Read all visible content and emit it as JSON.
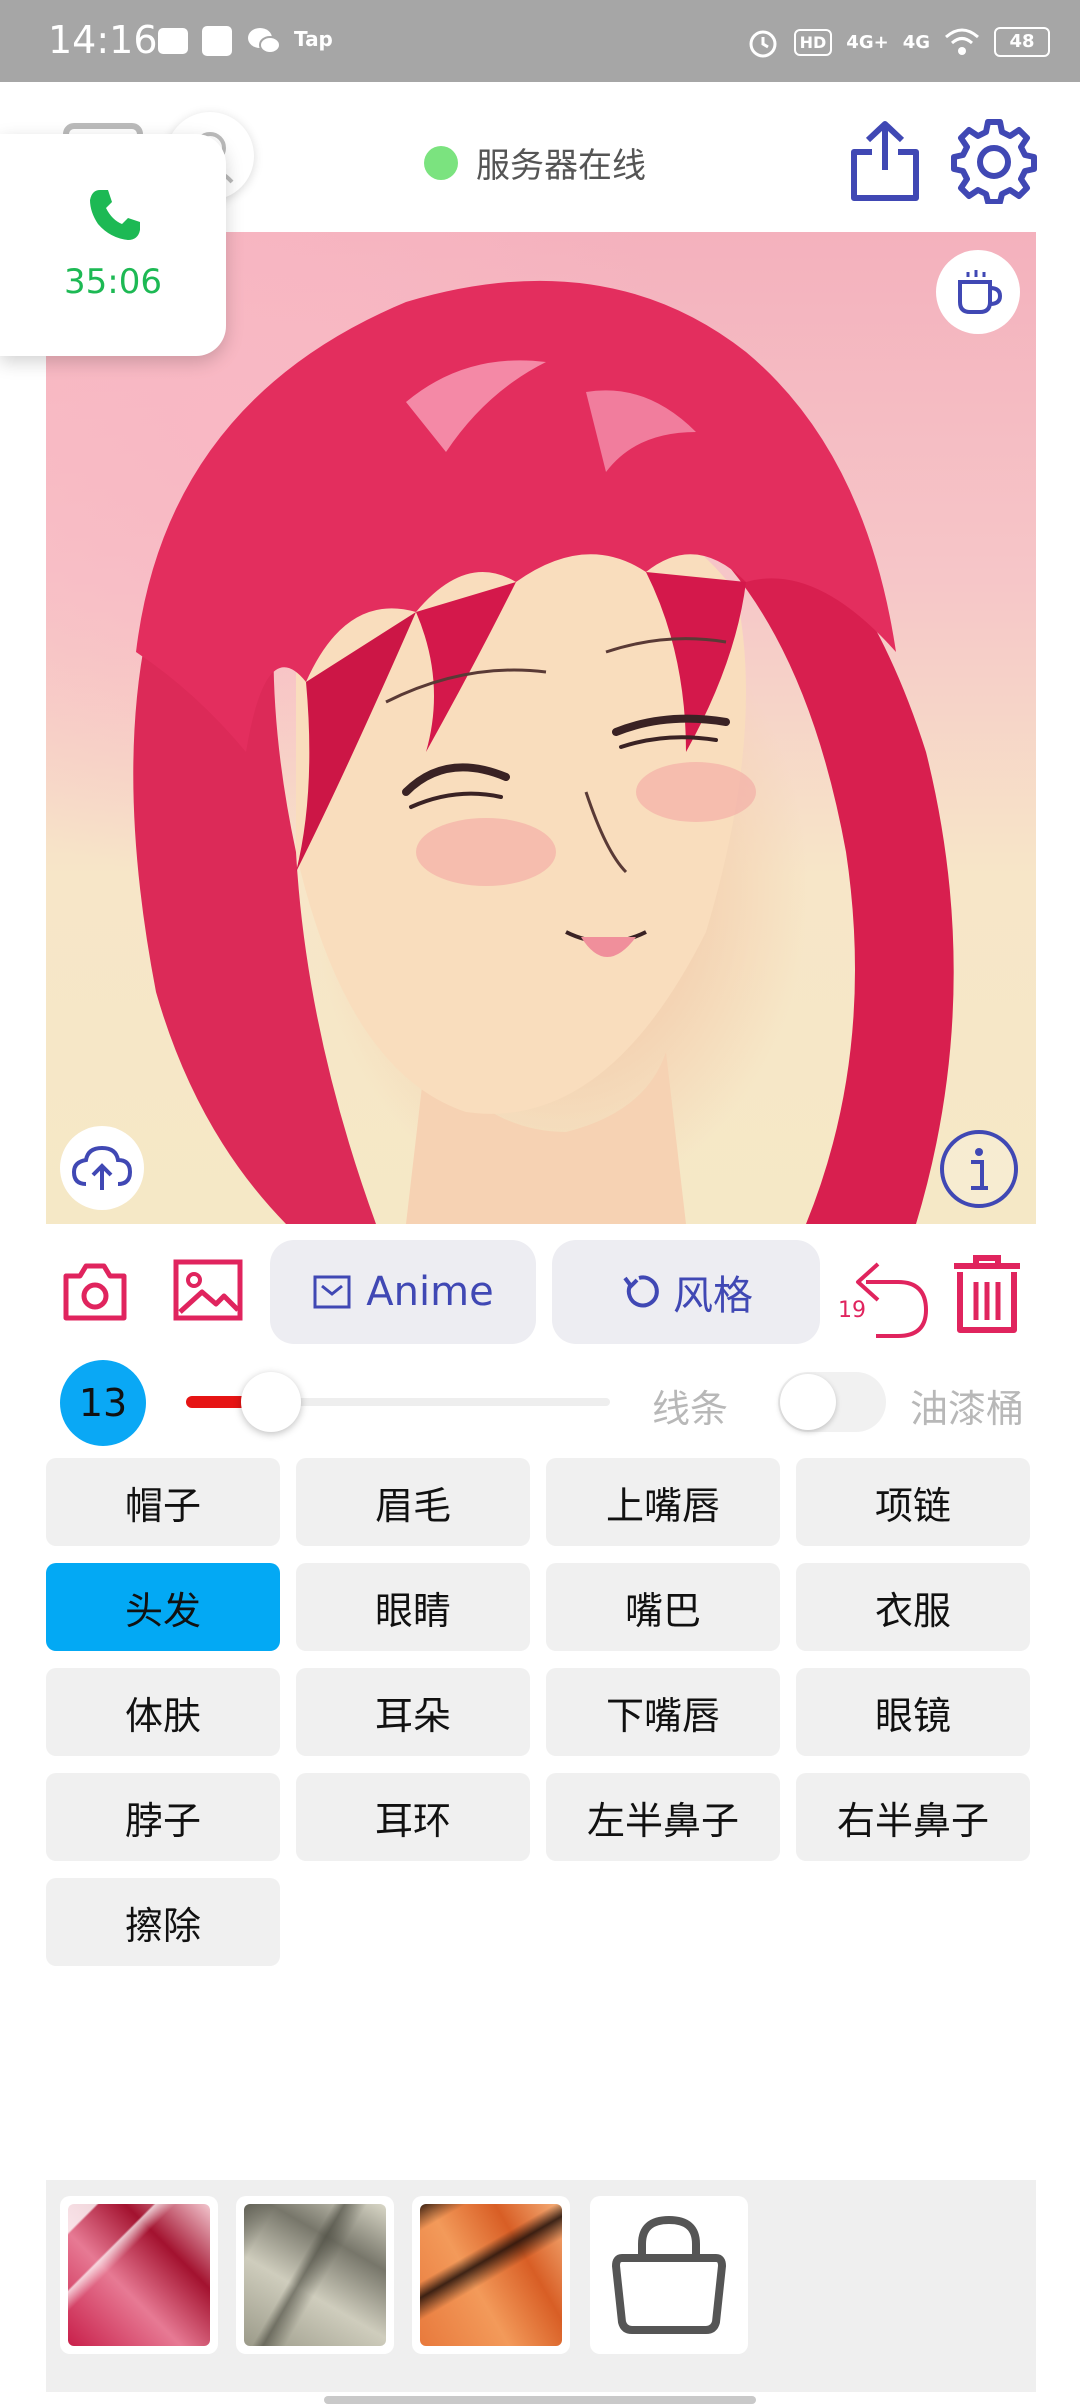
{
  "status_bar": {
    "time": "14:16",
    "tap_label": "Tap",
    "hd_badge": "HD",
    "net1": "4G+",
    "net2": "4G",
    "battery": "48"
  },
  "header": {
    "server_status": "服务器在线",
    "status_color": "#7be37f"
  },
  "call": {
    "timer": "35:06",
    "color": "#1db954"
  },
  "toolbar": {
    "anime_label": "Anime",
    "style_label": "风格",
    "undo_count": "19",
    "accent": "#e0245e",
    "primary": "#4048b4"
  },
  "brush": {
    "size": "13",
    "slider_value": 0.2,
    "lines_label": "线条",
    "lines_toggle": false,
    "bucket_label": "油漆桶"
  },
  "parts": [
    {
      "label": "帽子",
      "active": false
    },
    {
      "label": "眉毛",
      "active": false
    },
    {
      "label": "上嘴唇",
      "active": false
    },
    {
      "label": "项链",
      "active": false
    },
    {
      "label": "头发",
      "active": true
    },
    {
      "label": "眼睛",
      "active": false
    },
    {
      "label": "嘴巴",
      "active": false
    },
    {
      "label": "衣服",
      "active": false
    },
    {
      "label": "体肤",
      "active": false
    },
    {
      "label": "耳朵",
      "active": false
    },
    {
      "label": "下嘴唇",
      "active": false
    },
    {
      "label": "眼镜",
      "active": false
    },
    {
      "label": "脖子",
      "active": false
    },
    {
      "label": "耳环",
      "active": false
    },
    {
      "label": "左半鼻子",
      "active": false
    },
    {
      "label": "右半鼻子",
      "active": false
    },
    {
      "label": "擦除",
      "active": false
    }
  ],
  "palette": {
    "textures": [
      "red-texture",
      "gray-texture",
      "orange-texture"
    ],
    "store_icon": "shopping-bag-icon"
  }
}
